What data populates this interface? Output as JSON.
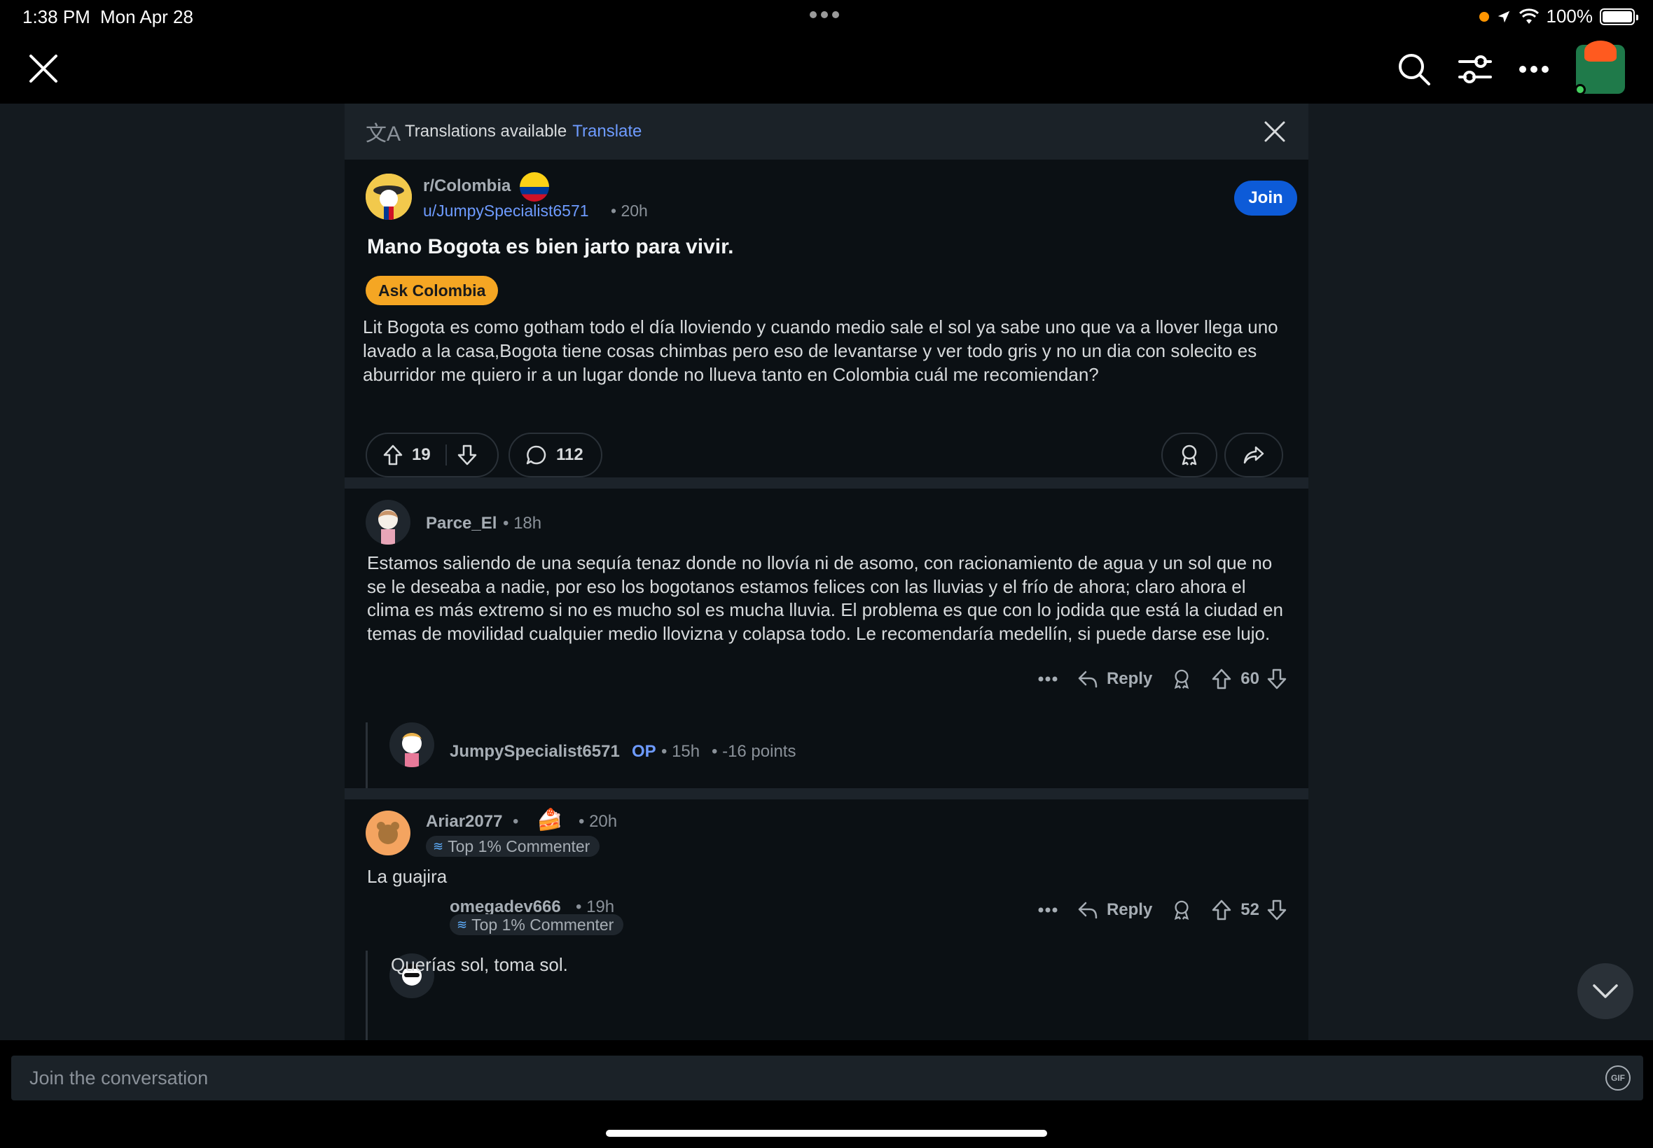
{
  "status": {
    "time": "1:38 PM",
    "date": "Mon Apr 28",
    "battery": "100%"
  },
  "translate": {
    "text": "Translations available",
    "link": "Translate"
  },
  "post": {
    "subreddit": "r/Colombia",
    "author": "u/JumpySpecialist6571",
    "time": "• 20h",
    "join_label": "Join",
    "title": "Mano Bogota es bien jarto para vivir.",
    "flair": "Ask Colombia",
    "body": "Lit Bogota es como gotham todo el día lloviendo y cuando medio sale el sol ya sabe uno que va a llover llega uno lavado a la casa,Bogota tiene cosas chimbas pero eso de  levantarse y ver todo gris y no un dia con solecito es aburridor me quiero ir a un lugar donde no llueva tanto en Colombia cuál me recomiendan?",
    "votes": "19",
    "comments": "112"
  },
  "comments": [
    {
      "author": "Parce_El",
      "time": "• 18h",
      "body": "Estamos saliendo de una sequía tenaz donde no llovía ni de asomo, con racionamiento de agua y un sol que no se le deseaba a nadie, por eso los bogotanos estamos felices con las lluvias y el frío de ahora; claro ahora el clima es más extremo si no es mucho sol es mucha lluvia. El problema es que con lo jodida que está la ciudad en temas de movilidad cualquier medio llovizna y colapsa todo. Le recomendaría medellín, si puede darse ese lujo.",
      "reply_label": "Reply",
      "score": "60",
      "reply": {
        "author": "JumpySpecialist6571",
        "op": "OP",
        "time": "• 15h",
        "points": "• -16 points"
      }
    },
    {
      "author": "Ariar2077",
      "sep": "•",
      "time": "• 20h",
      "badge": "Top 1% Commenter",
      "body": "La guajira",
      "reply_label": "Reply",
      "score": "52",
      "reply": {
        "author": "omegadev666",
        "time": "• 19h",
        "badge": "Top 1% Commenter",
        "body": "Querías sol, toma sol."
      }
    }
  ],
  "composer": {
    "placeholder": "Join the conversation",
    "gif": "GIF"
  },
  "colors": {
    "accent": "#6e9bff",
    "join": "#0d5bd8",
    "flair": "#f5a623",
    "background": "#141a1f",
    "card": "#0b1014"
  }
}
